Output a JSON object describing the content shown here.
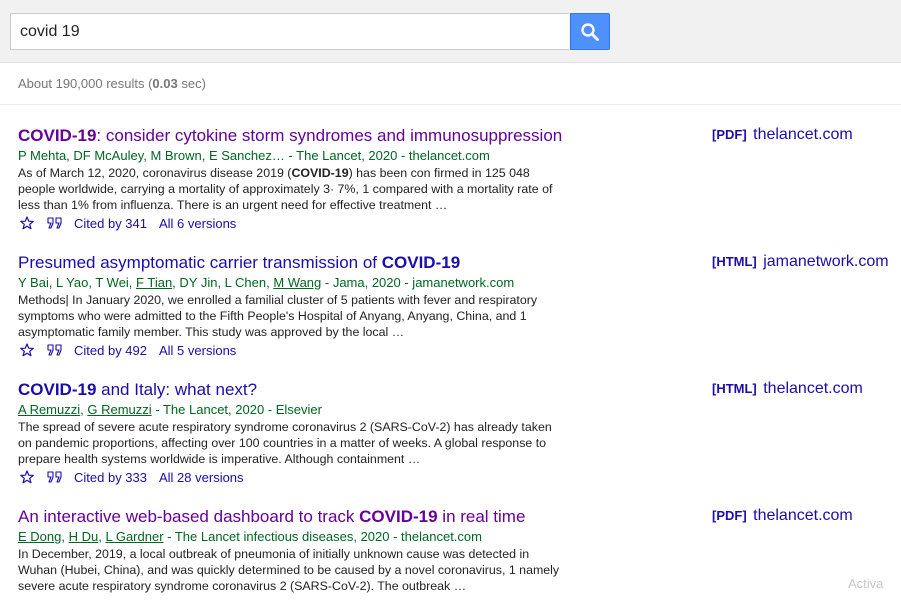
{
  "search": {
    "query": "covid 19"
  },
  "stats": {
    "prefix": "About 190,000 results (",
    "time": "0.03",
    "suffix": " sec)"
  },
  "results": [
    {
      "title_parts": [
        {
          "text": "COVID-19",
          "bold": true
        },
        {
          "text": ": consider cytokine storm syndromes and immunosuppression",
          "bold": false
        }
      ],
      "visited": true,
      "authors": "P Mehta, DF McAuley, M Brown, E Sanchez… - The Lancet, 2020 - thelancet.com",
      "snippet_parts": [
        {
          "text": "As of March 12, 2020, coronavirus disease 2019 (",
          "bold": false
        },
        {
          "text": "COVID-19",
          "bold": true
        },
        {
          "text": ") has been con firmed in 125 048 people worldwide, carrying a mortality of approximately 3· 7%, 1 compared with a mortality rate of less than 1% from influenza. There is an urgent need for effective treatment …",
          "bold": false
        }
      ],
      "cited_by": "Cited by 341",
      "versions": "All 6 versions",
      "side_format": "[PDF]",
      "side_site": "thelancet.com"
    },
    {
      "title_parts": [
        {
          "text": "Presumed asymptomatic carrier transmission of ",
          "bold": false
        },
        {
          "text": "COVID-19",
          "bold": true
        }
      ],
      "visited": false,
      "authors_parts": [
        {
          "text": "Y Bai, L Yao, T Wei, ",
          "link": false
        },
        {
          "text": "F Tian",
          "link": true
        },
        {
          "text": ", DY Jin, L Chen, ",
          "link": false
        },
        {
          "text": "M Wang",
          "link": true
        },
        {
          "text": " - Jama, 2020 - jamanetwork.com",
          "link": false
        }
      ],
      "snippet_parts": [
        {
          "text": "Methods| In January 2020, we enrolled a familial cluster of 5 patients with fever and respiratory symptoms who were admitted to the Fifth People's Hospital of Anyang, Anyang, China, and 1 asymptomatic family member. This study was approved by the local …",
          "bold": false
        }
      ],
      "cited_by": "Cited by 492",
      "versions": "All 5 versions",
      "side_format": "[HTML]",
      "side_site": "jamanetwork.com"
    },
    {
      "title_parts": [
        {
          "text": "COVID-19",
          "bold": true
        },
        {
          "text": " and Italy: what next?",
          "bold": false
        }
      ],
      "visited": false,
      "authors_parts": [
        {
          "text": "A Remuzzi",
          "link": true
        },
        {
          "text": ", ",
          "link": false
        },
        {
          "text": "G Remuzzi",
          "link": true
        },
        {
          "text": " - The Lancet, 2020 - Elsevier",
          "link": false
        }
      ],
      "snippet_parts": [
        {
          "text": "The spread of severe acute respiratory syndrome coronavirus 2 (SARS-CoV-2) has already taken on pandemic proportions, affecting over 100 countries in a matter of weeks. A global response to prepare health systems worldwide is imperative. Although containment …",
          "bold": false
        }
      ],
      "cited_by": "Cited by 333",
      "versions": "All 28 versions",
      "side_format": "[HTML]",
      "side_site": "thelancet.com"
    },
    {
      "title_parts": [
        {
          "text": "An interactive web-based dashboard to track ",
          "bold": false
        },
        {
          "text": "COVID-19",
          "bold": true
        },
        {
          "text": " in real time",
          "bold": false
        }
      ],
      "visited": true,
      "authors_parts": [
        {
          "text": "E Dong",
          "link": true
        },
        {
          "text": ", ",
          "link": false
        },
        {
          "text": "H Du",
          "link": true
        },
        {
          "text": ", ",
          "link": false
        },
        {
          "text": "L Gardner",
          "link": true
        },
        {
          "text": " - The Lancet infectious diseases, 2020 - thelancet.com",
          "link": false
        }
      ],
      "snippet_parts": [
        {
          "text": "In December, 2019, a local outbreak of pneumonia of initially unknown cause was detected in Wuhan (Hubei, China), and was quickly determined to be caused by a novel coronavirus, 1 namely severe acute respiratory syndrome coronavirus 2 (SARS-CoV-2). The outbreak …",
          "bold": false
        }
      ],
      "cited_by": "",
      "versions": "",
      "side_format": "[PDF]",
      "side_site": "thelancet.com"
    }
  ],
  "watermark": "Activa",
  "colors": {
    "visited_title": "#660099",
    "link": "#1a0dab",
    "authors": "#006621",
    "search_button": "#4d90fe"
  },
  "icons": {
    "search_button": "magnifier-icon",
    "save": "star-icon",
    "cite": "quote-icon"
  }
}
